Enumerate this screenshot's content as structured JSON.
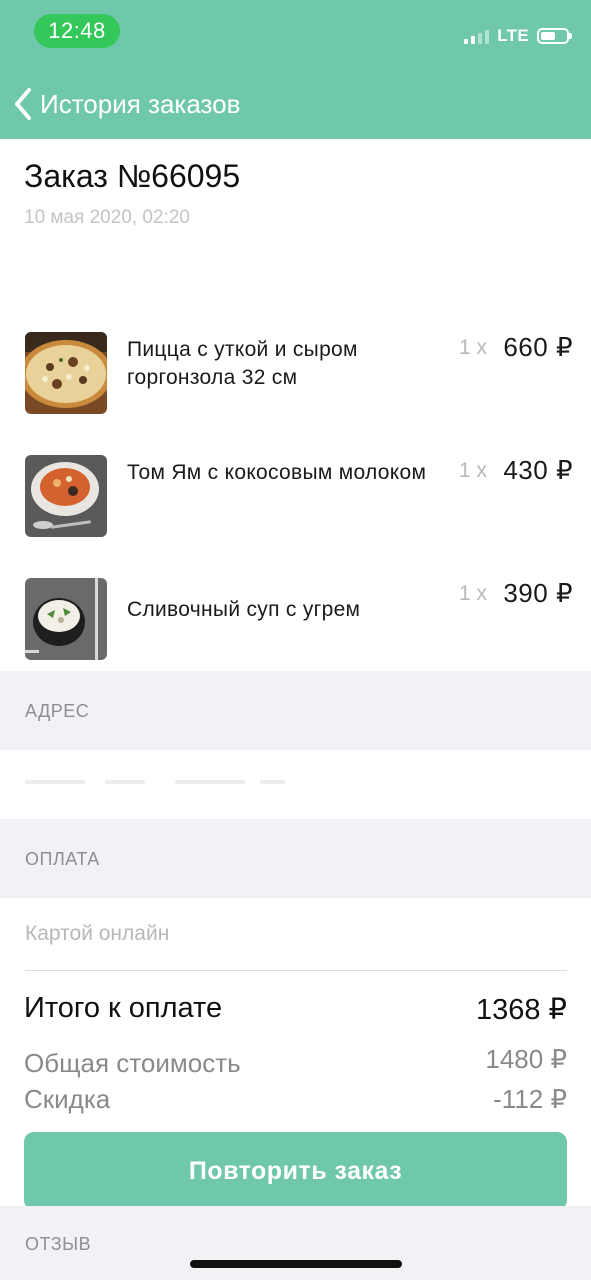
{
  "status_bar": {
    "time": "12:48",
    "network": "LTE"
  },
  "nav": {
    "back_label": "История заказов",
    "header_color": "#6fc8ab"
  },
  "order": {
    "title": "Заказ №66095",
    "date": "10 мая 2020, 02:20"
  },
  "items": [
    {
      "name": "Пицца с уткой и сыром горгонзола 32 см",
      "qty": "1 x",
      "price": "660 ₽",
      "image": "pizza-photo"
    },
    {
      "name": "Том Ям с кокосовым молоком",
      "qty": "1 x",
      "price": "430 ₽",
      "image": "tom-yam-soup-photo"
    },
    {
      "name": "Сливочный суп с угрем",
      "qty": "1 x",
      "price": "390 ₽",
      "image": "cream-soup-photo"
    }
  ],
  "address": {
    "header": "АДРЕС"
  },
  "payment": {
    "header": "ОПЛАТА",
    "method": "Картой онлайн"
  },
  "totals": {
    "total_label": "Итого к оплате",
    "total_value": "1368 ₽",
    "subtotal_label": "Общая стоимость",
    "subtotal_value": "1480 ₽",
    "discount_label": "Скидка",
    "discount_value": "-112 ₽"
  },
  "actions": {
    "repeat_label": "Повторить заказ"
  },
  "review": {
    "header": "ОТЗЫВ"
  }
}
